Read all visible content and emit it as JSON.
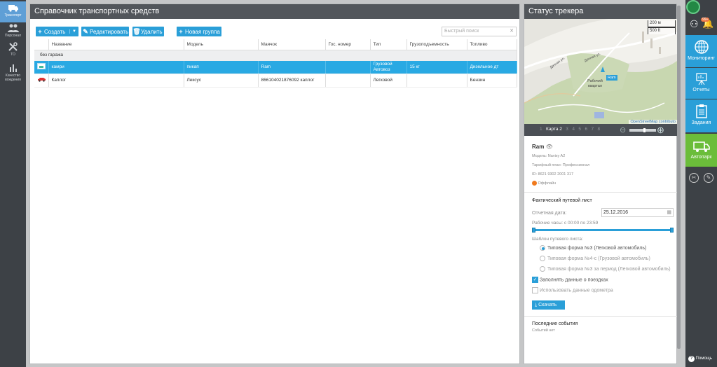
{
  "left_nav": [
    {
      "label": "Транспорт",
      "icon": "truck-icon"
    },
    {
      "label": "Персонал",
      "icon": "people-icon"
    },
    {
      "label": "ТО",
      "icon": "wrench-icon"
    },
    {
      "label": "Качество вождения",
      "icon": "bar-chart-icon"
    }
  ],
  "vehicles": {
    "title": "Справочник транспортных средств",
    "create": "Создать",
    "edit": "Редактировать",
    "delete": "Удалить",
    "new_group": "Новая группа",
    "search_placeholder": "Быстрый поиск",
    "columns": [
      "Название",
      "Модель",
      "Маячок",
      "Гос. номер",
      "Тип",
      "Грузоподъемность",
      "Топливо"
    ],
    "group_label": "без гаража",
    "rows": [
      {
        "name": "камри",
        "model": "пикап",
        "beacon": "Ram",
        "plate": "",
        "type": "Грузовой Автовоз",
        "capacity": "15 кг",
        "fuel": "Дизельное дт",
        "selected": true
      },
      {
        "name": "Каплог",
        "model": "Лексус",
        "beacon": "866104021876092 каплог",
        "plate": "",
        "type": "Легковой",
        "capacity": "",
        "fuel": "Бензин",
        "selected": false
      }
    ]
  },
  "tracker": {
    "title": "Статус трекера",
    "map": {
      "scale_m": "200 м",
      "scale_ft": "500 ft",
      "attrib": "OpenStreetMap contributo",
      "area": "Рабочий квартал",
      "street1": "Дачная ул.",
      "street2": "Дачная ул.",
      "marker": "Ram"
    },
    "pages": [
      "1",
      "Карта 2",
      "3",
      "4",
      "5",
      "6",
      "7",
      "8"
    ],
    "device": {
      "name": "Ram",
      "model": "Модель: Navixy A2",
      "plan": "Тарифный план: Профессионал",
      "id": "ID: 8621 9302 2001 317",
      "status": "Оффлайн"
    },
    "trip": {
      "title": "Фактический путевой лист",
      "date_label": "Отчетная дата:",
      "date_value": "25.12.2016",
      "hours": "Рабочие часы: с 00:00 по 23:59",
      "template_label": "Шаблон путевого листа:",
      "templates": [
        "Типовая форма №3 (Легковой автомобиль)",
        "Типовая форма №4-с (Грузовой автомобиль)",
        "Типовая форма №3 за период (Легковой автомобиль)"
      ],
      "selected_template": 0,
      "fill_trips": "Заполнять данные о поездках",
      "fill_trips_checked": true,
      "odometer": "Использовать данные одометра",
      "odometer_checked": false,
      "download": "Скачать"
    },
    "events": {
      "title": "Последние события",
      "empty": "Событий нет"
    }
  },
  "right_nav": {
    "badge": "99+",
    "items": [
      {
        "label": "Мониторинг",
        "icon": "globe-icon"
      },
      {
        "label": "Отчеты",
        "icon": "easel-chart-icon"
      },
      {
        "label": "Задания",
        "icon": "clipboard-icon"
      },
      {
        "label": "Автопарк",
        "icon": "van-icon",
        "active": true
      }
    ],
    "help": "Помощь"
  },
  "colors": {
    "accent": "#2a9fd8",
    "selected_row": "#29a9e3",
    "active_nav": "#6bbd3a",
    "offline": "#f07a1e"
  }
}
